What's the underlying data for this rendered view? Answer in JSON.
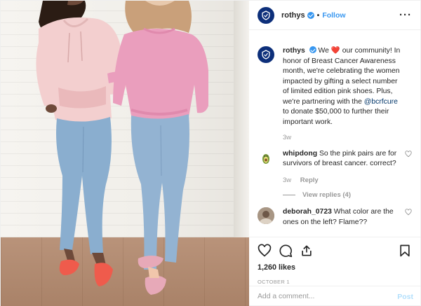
{
  "post": {
    "username": "rothys",
    "follow_label": "Follow",
    "separator": "•",
    "more_label": "···",
    "icons": {
      "logo": "rothys-logo-icon",
      "verified": "verified-badge-icon",
      "more": "more-options-icon"
    }
  },
  "caption": {
    "username": "rothys",
    "text_before_heart": "We",
    "heart": "❤️",
    "text_after_heart": "our community! In honor of Breast Cancer Awareness month, we're celebrating the women impacted by gifting a select number of limited edition pink shoes. Plus, we're partnering with the",
    "mention": "@bcrfcure",
    "text_end": "to donate $50,000 to further their important work.",
    "time": "3w"
  },
  "comments": [
    {
      "username": "whipdong",
      "text": "So the pink pairs are for survivors of breast cancer. correct?",
      "time": "3w",
      "reply_label": "Reply",
      "view_replies": "View replies (4)"
    },
    {
      "username": "deborah_0723",
      "text": "What color are the ones on the left? Flame??"
    }
  ],
  "actions": {
    "icons": [
      "heart-icon",
      "comment-icon",
      "share-icon",
      "bookmark-icon"
    ],
    "likes": "1,260 likes",
    "date": "OCTOBER 1"
  },
  "add_comment": {
    "placeholder": "Add a comment...",
    "post_label": "Post"
  },
  "colors": {
    "accent": "#3897f0",
    "post_disabled": "#b2dffc",
    "brand_navy": "#0d2f7a",
    "like_red": "#ed4956"
  }
}
